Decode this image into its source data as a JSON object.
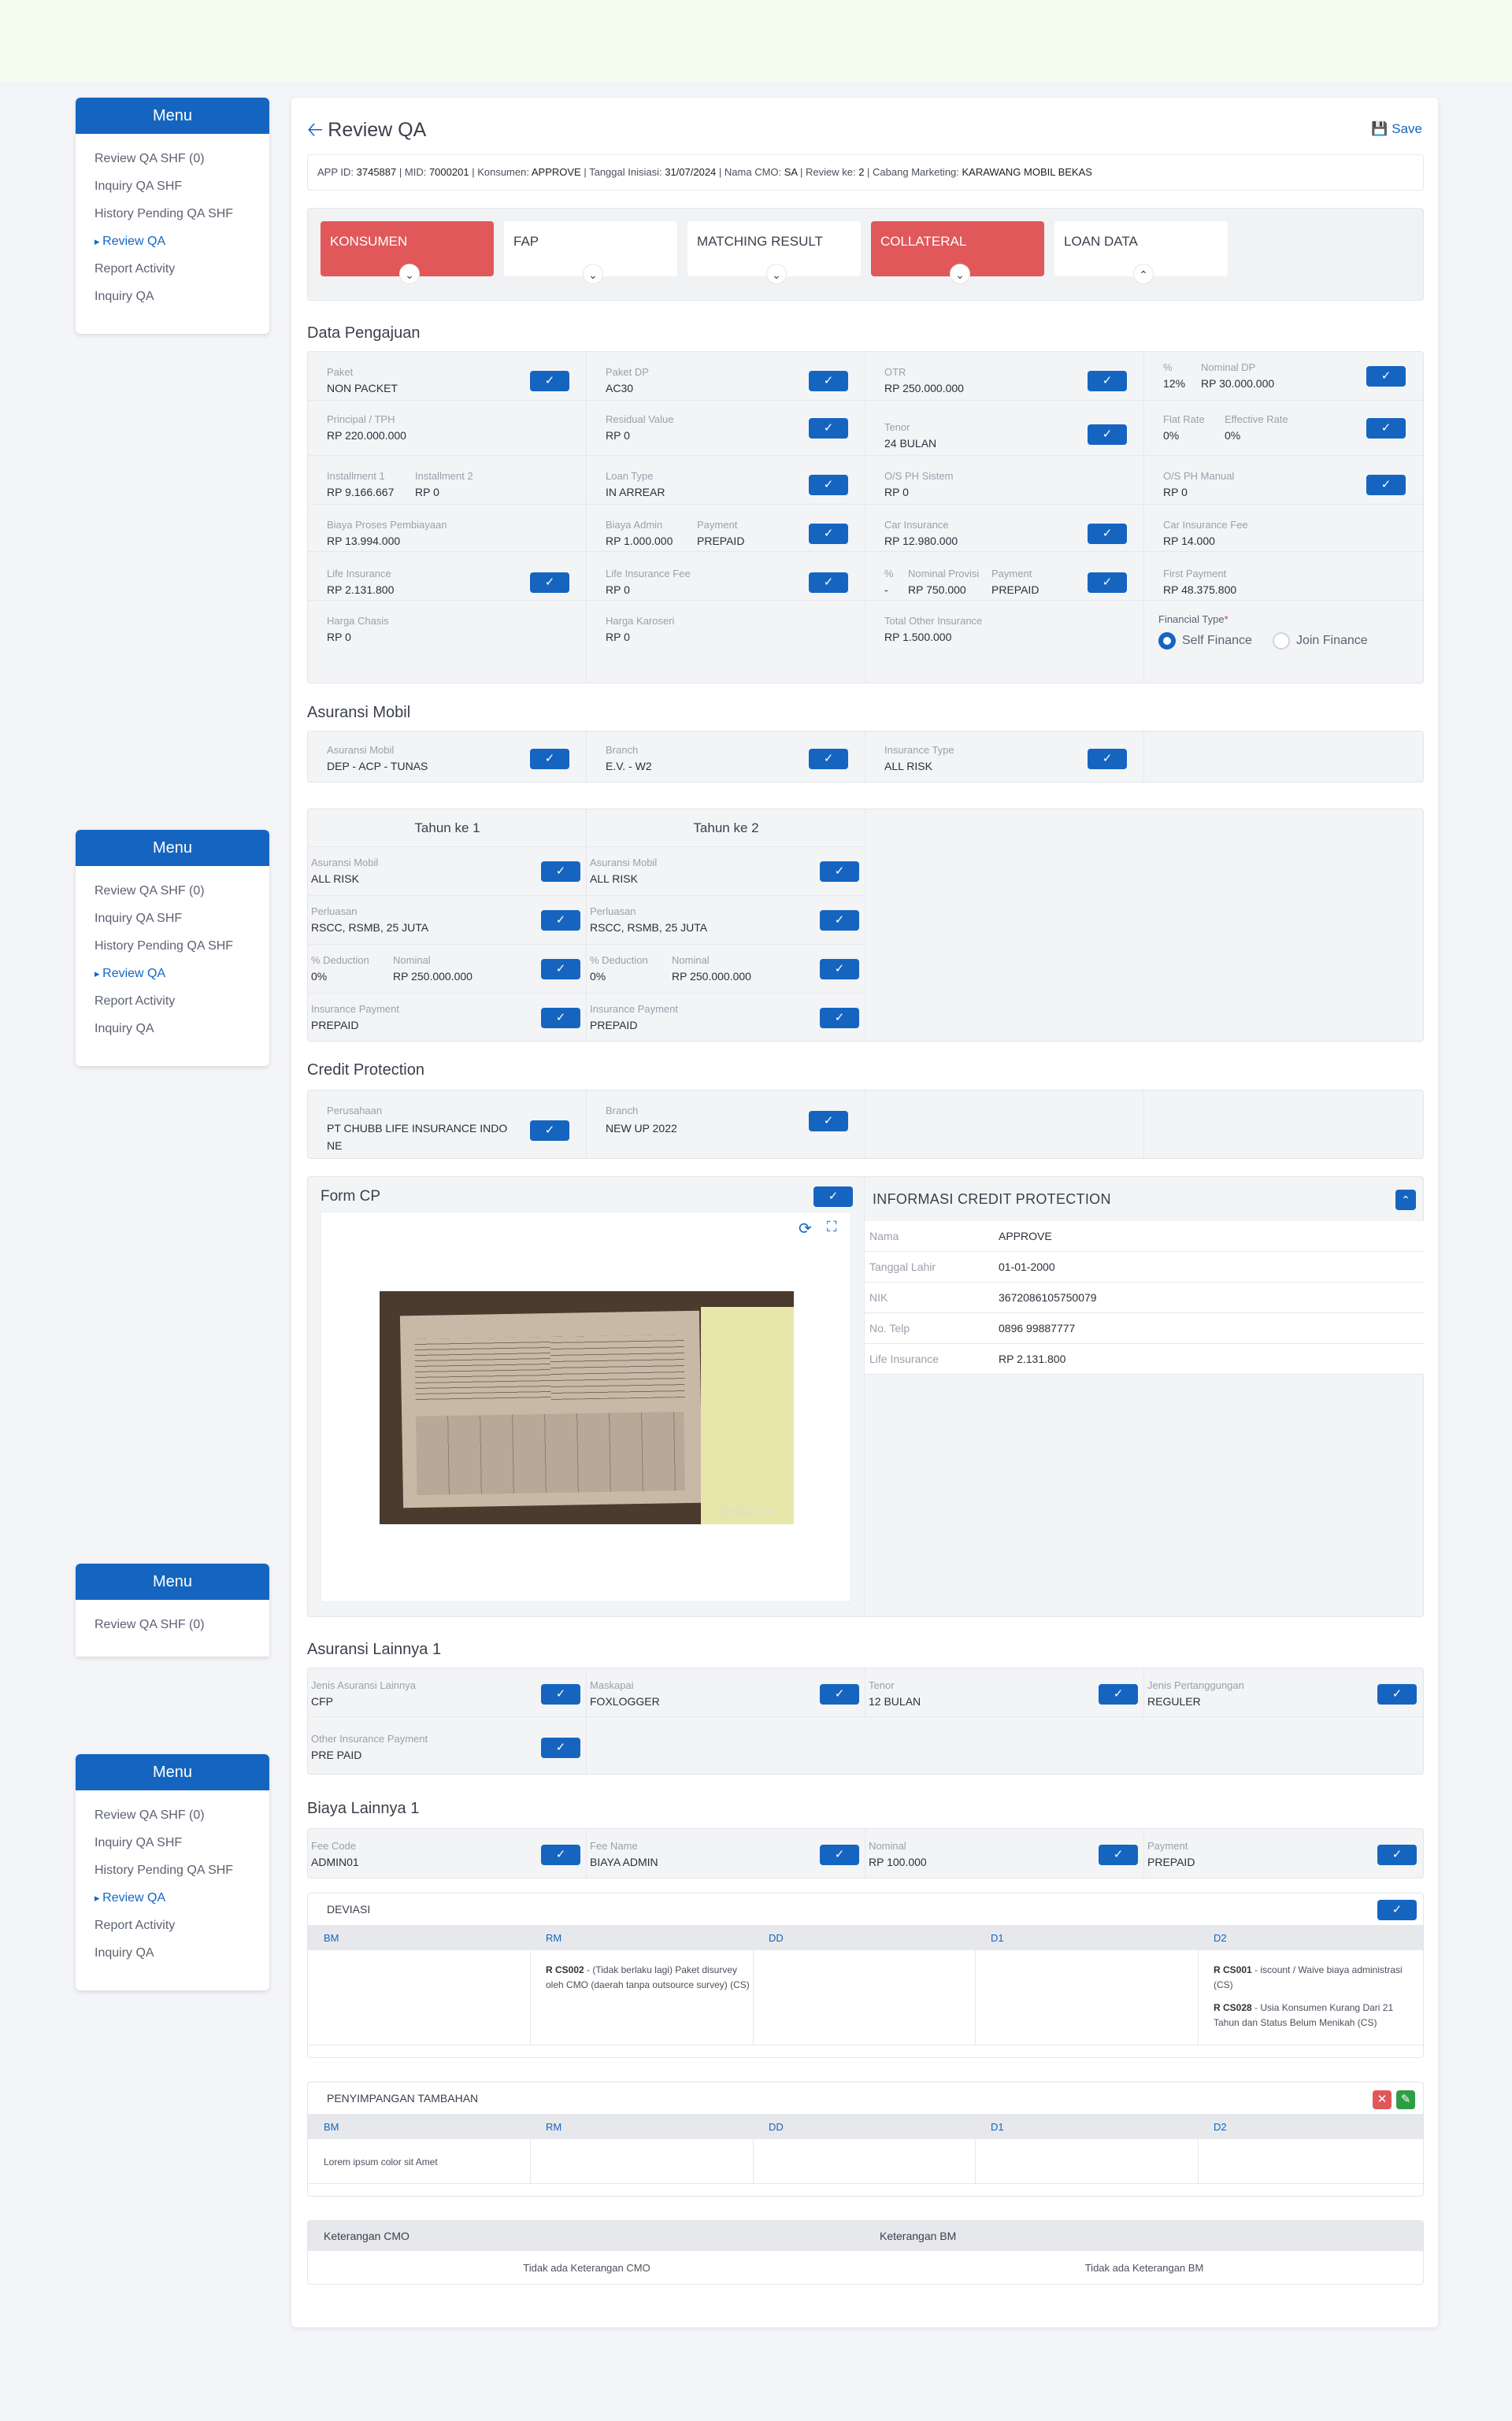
{
  "menu": {
    "title": "Menu",
    "items": [
      "Review QA SHF (0)",
      "Inquiry QA SHF",
      "History Pending QA SHF",
      "Review QA",
      "Report Activity",
      "Inquiry QA"
    ]
  },
  "page": {
    "title": "Review QA",
    "save_label": "Save"
  },
  "info": {
    "app_id_label": "APP ID:",
    "app_id": "3745887",
    "mid_label": "MID:",
    "mid": "7000201",
    "konsumen_label": "Konsumen:",
    "konsumen": "APPROVE",
    "tanggal_label": "Tanggal Inisiasi:",
    "tanggal": "31/07/2024",
    "cmo_label": "Nama CMO:",
    "cmo": "SA",
    "review_label": "Review ke:",
    "review": "2",
    "cabang_label": "Cabang Marketing:",
    "cabang": "KARAWANG MOBIL BEKAS"
  },
  "tabs": [
    {
      "label": "KONSUMEN",
      "icon": "chevron-down"
    },
    {
      "label": "FAP",
      "icon": "chevron-down"
    },
    {
      "label": "MATCHING RESULT",
      "icon": "chevron-down"
    },
    {
      "label": "COLLATERAL",
      "icon": "chevron-down"
    },
    {
      "label": "LOAN DATA",
      "icon": "chevron-up"
    }
  ],
  "data_pengajuan": {
    "title": "Data Pengajuan",
    "paket_label": "Paket",
    "paket": "NON PACKET",
    "paket_dp_label": "Paket DP",
    "paket_dp": "AC30",
    "otr_label": "OTR",
    "otr": "RP 250.000.000",
    "pct_label": "%",
    "pct": "12%",
    "nominal_dp_label": "Nominal DP",
    "nominal_dp": "RP 30.000.000",
    "principal_label": "Principal / TPH",
    "principal": "RP 220.000.000",
    "residual_label": "Residual Value",
    "residual": "RP 0",
    "tenor_label": "Tenor",
    "tenor": "24 BULAN",
    "flat_label": "Flat Rate",
    "flat": "0%",
    "eff_label": "Effective Rate",
    "eff": "0%",
    "inst1_label": "Installment 1",
    "inst1": "RP 9.166.667",
    "inst2_label": "Installment 2",
    "inst2": "RP 0",
    "loan_type_label": "Loan Type",
    "loan_type": "IN ARREAR",
    "os_sistem_label": "O/S PH Sistem",
    "os_sistem": "RP 0",
    "os_manual_label": "O/S PH Manual",
    "os_manual": "RP 0",
    "biaya_proses_label": "Biaya Proses Pembiayaan",
    "biaya_proses": "RP 13.994.000",
    "biaya_admin_label": "Biaya Admin",
    "biaya_admin": "RP 1.000.000",
    "payment_label": "Payment",
    "payment": "PREPAID",
    "car_ins_label": "Car Insurance",
    "car_ins": "RP 12.980.000",
    "car_ins_fee_label": "Car Insurance Fee",
    "car_ins_fee": "RP 14.000",
    "life_ins_label": "Life Insurance",
    "life_ins": "RP 2.131.800",
    "life_ins_fee_label": "Life Insurance Fee",
    "life_ins_fee": "RP 0",
    "prov_pct_label": "%",
    "prov_pct": "-",
    "prov_nom_label": "Nominal Provisi",
    "prov_nom": "RP 750.000",
    "prov_pay_label": "Payment",
    "prov_pay": "PREPAID",
    "first_pay_label": "First Payment",
    "first_pay": "RP 48.375.800",
    "chasis_label": "Harga Chasis",
    "chasis": "RP 0",
    "karoseri_label": "Harga Karoseri",
    "karoseri": "RP 0",
    "other_ins_label": "Total Other Insurance",
    "other_ins": "RP 1.500.000",
    "fin_type_label": "Financial Type",
    "fin_opt1": "Self Finance",
    "fin_opt2": "Join Finance"
  },
  "asuransi_mobil": {
    "title": "Asuransi Mobil",
    "asuransi_label": "Asuransi Mobil",
    "asuransi": "DEP - ACP - TUNAS",
    "branch_label": "Branch",
    "branch": "E.V. - W2",
    "type_label": "Insurance Type",
    "type": "ALL RISK",
    "years": [
      {
        "title": "Tahun ke 1",
        "am_label": "Asuransi Mobil",
        "am": "ALL RISK",
        "perluasan_label": "Perluasan",
        "perluasan": "RSCC, RSMB, 25 JUTA",
        "ded_label": "% Deduction",
        "ded": "0%",
        "nom_label": "Nominal",
        "nom": "RP 250.000.000",
        "pay_label": "Insurance Payment",
        "pay": "PREPAID"
      },
      {
        "title": "Tahun ke 2",
        "am_label": "Asuransi Mobil",
        "am": "ALL RISK",
        "perluasan_label": "Perluasan",
        "perluasan": "RSCC, RSMB, 25 JUTA",
        "ded_label": "% Deduction",
        "ded": "0%",
        "nom_label": "Nominal",
        "nom": "RP 250.000.000",
        "pay_label": "Insurance Payment",
        "pay": "PREPAID"
      }
    ]
  },
  "credit_protection": {
    "title": "Credit Protection",
    "perusahaan_label": "Perusahaan",
    "perusahaan_1": "PT CHUBB LIFE INSURANCE INDO",
    "perusahaan_2": "NE",
    "branch_label": "Branch",
    "branch": "NEW UP 2022",
    "form_cp_title": "Form CP",
    "info_title": "INFORMASI CREDIT PROTECTION",
    "info": [
      {
        "k": "Nama",
        "v": "APPROVE"
      },
      {
        "k": "Tanggal Lahir",
        "v": "01-01-2000"
      },
      {
        "k": "NIK",
        "v": "3672086105750079"
      },
      {
        "k": "No. Telp",
        "v": "0896 99887777"
      },
      {
        "k": "Life Insurance",
        "v": "RP 2.131.800"
      }
    ],
    "photo_watermark": "detikcom"
  },
  "asuransi_lainnya": {
    "title": "Asuransi Lainnya 1",
    "jenis_label": "Jenis Asuransi Lainnya",
    "jenis": "CFP",
    "maskapai_label": "Maskapai",
    "maskapai": "FOXLOGGER",
    "tenor_label": "Tenor",
    "tenor": "12 BULAN",
    "pertanggungan_label": "Jenis Pertanggungan",
    "pertanggungan": "REGULER",
    "other_pay_label": "Other Insurance Payment",
    "other_pay": "PRE PAID"
  },
  "biaya_lainnya": {
    "title": "Biaya Lainnya 1",
    "fee_code_label": "Fee Code",
    "fee_code": "ADMIN01",
    "fee_name_label": "Fee Name",
    "fee_name": "BIAYA ADMIN",
    "nominal_label": "Nominal",
    "nominal": "RP 100.000",
    "payment_label": "Payment",
    "payment": "PREPAID"
  },
  "deviasi": {
    "title": "DEVIASI",
    "cols": [
      "BM",
      "RM",
      "DD",
      "D1",
      "D2"
    ],
    "rm_code": "R CS002",
    "rm_text": " - (Tidak berlaku lagi) Paket disurvey oleh CMO (daerah tanpa outsource survey) (CS)",
    "d2_code1": "R CS001",
    "d2_text1": " - iscount / Waive biaya administrasi (CS)",
    "d2_code2": "R CS028",
    "d2_text2": " - Usia Konsumen Kurang Dari 21 Tahun dan Status Belum Menikah (CS)"
  },
  "penyimpangan": {
    "title": "PENYIMPANGAN TAMBAHAN",
    "cols": [
      "BM",
      "RM",
      "DD",
      "D1",
      "D2"
    ],
    "bm_text": "Lorem ipsum color sit Amet"
  },
  "keterangan": {
    "cmo_label": "Keterangan CMO",
    "cmo": "Tidak ada Keterangan CMO",
    "bm_label": "Keterangan BM",
    "bm": "Tidak ada Keterangan BM"
  },
  "colors": {
    "primary": "#1565c0",
    "danger": "#e0585a",
    "success": "#2e9e44",
    "top_band": "#f5fdf0"
  }
}
